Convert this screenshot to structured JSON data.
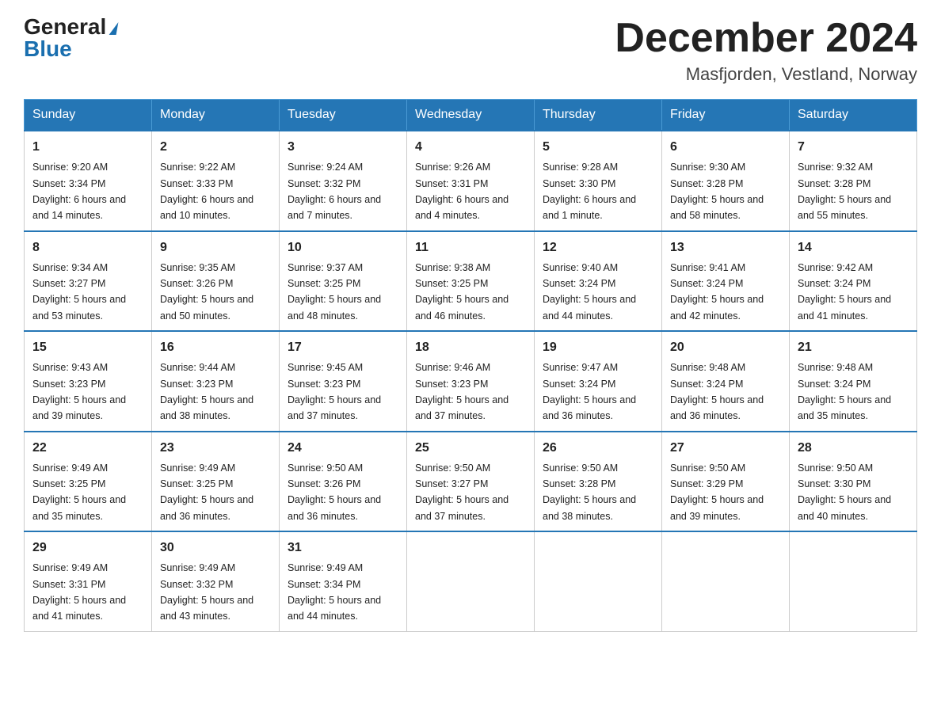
{
  "header": {
    "logo": {
      "general": "General",
      "blue": "Blue"
    },
    "month_title": "December 2024",
    "location": "Masfjorden, Vestland, Norway"
  },
  "days_of_week": [
    "Sunday",
    "Monday",
    "Tuesday",
    "Wednesday",
    "Thursday",
    "Friday",
    "Saturday"
  ],
  "weeks": [
    [
      {
        "day": "1",
        "sunrise": "9:20 AM",
        "sunset": "3:34 PM",
        "daylight": "6 hours and 14 minutes."
      },
      {
        "day": "2",
        "sunrise": "9:22 AM",
        "sunset": "3:33 PM",
        "daylight": "6 hours and 10 minutes."
      },
      {
        "day": "3",
        "sunrise": "9:24 AM",
        "sunset": "3:32 PM",
        "daylight": "6 hours and 7 minutes."
      },
      {
        "day": "4",
        "sunrise": "9:26 AM",
        "sunset": "3:31 PM",
        "daylight": "6 hours and 4 minutes."
      },
      {
        "day": "5",
        "sunrise": "9:28 AM",
        "sunset": "3:30 PM",
        "daylight": "6 hours and 1 minute."
      },
      {
        "day": "6",
        "sunrise": "9:30 AM",
        "sunset": "3:28 PM",
        "daylight": "5 hours and 58 minutes."
      },
      {
        "day": "7",
        "sunrise": "9:32 AM",
        "sunset": "3:28 PM",
        "daylight": "5 hours and 55 minutes."
      }
    ],
    [
      {
        "day": "8",
        "sunrise": "9:34 AM",
        "sunset": "3:27 PM",
        "daylight": "5 hours and 53 minutes."
      },
      {
        "day": "9",
        "sunrise": "9:35 AM",
        "sunset": "3:26 PM",
        "daylight": "5 hours and 50 minutes."
      },
      {
        "day": "10",
        "sunrise": "9:37 AM",
        "sunset": "3:25 PM",
        "daylight": "5 hours and 48 minutes."
      },
      {
        "day": "11",
        "sunrise": "9:38 AM",
        "sunset": "3:25 PM",
        "daylight": "5 hours and 46 minutes."
      },
      {
        "day": "12",
        "sunrise": "9:40 AM",
        "sunset": "3:24 PM",
        "daylight": "5 hours and 44 minutes."
      },
      {
        "day": "13",
        "sunrise": "9:41 AM",
        "sunset": "3:24 PM",
        "daylight": "5 hours and 42 minutes."
      },
      {
        "day": "14",
        "sunrise": "9:42 AM",
        "sunset": "3:24 PM",
        "daylight": "5 hours and 41 minutes."
      }
    ],
    [
      {
        "day": "15",
        "sunrise": "9:43 AM",
        "sunset": "3:23 PM",
        "daylight": "5 hours and 39 minutes."
      },
      {
        "day": "16",
        "sunrise": "9:44 AM",
        "sunset": "3:23 PM",
        "daylight": "5 hours and 38 minutes."
      },
      {
        "day": "17",
        "sunrise": "9:45 AM",
        "sunset": "3:23 PM",
        "daylight": "5 hours and 37 minutes."
      },
      {
        "day": "18",
        "sunrise": "9:46 AM",
        "sunset": "3:23 PM",
        "daylight": "5 hours and 37 minutes."
      },
      {
        "day": "19",
        "sunrise": "9:47 AM",
        "sunset": "3:24 PM",
        "daylight": "5 hours and 36 minutes."
      },
      {
        "day": "20",
        "sunrise": "9:48 AM",
        "sunset": "3:24 PM",
        "daylight": "5 hours and 36 minutes."
      },
      {
        "day": "21",
        "sunrise": "9:48 AM",
        "sunset": "3:24 PM",
        "daylight": "5 hours and 35 minutes."
      }
    ],
    [
      {
        "day": "22",
        "sunrise": "9:49 AM",
        "sunset": "3:25 PM",
        "daylight": "5 hours and 35 minutes."
      },
      {
        "day": "23",
        "sunrise": "9:49 AM",
        "sunset": "3:25 PM",
        "daylight": "5 hours and 36 minutes."
      },
      {
        "day": "24",
        "sunrise": "9:50 AM",
        "sunset": "3:26 PM",
        "daylight": "5 hours and 36 minutes."
      },
      {
        "day": "25",
        "sunrise": "9:50 AM",
        "sunset": "3:27 PM",
        "daylight": "5 hours and 37 minutes."
      },
      {
        "day": "26",
        "sunrise": "9:50 AM",
        "sunset": "3:28 PM",
        "daylight": "5 hours and 38 minutes."
      },
      {
        "day": "27",
        "sunrise": "9:50 AM",
        "sunset": "3:29 PM",
        "daylight": "5 hours and 39 minutes."
      },
      {
        "day": "28",
        "sunrise": "9:50 AM",
        "sunset": "3:30 PM",
        "daylight": "5 hours and 40 minutes."
      }
    ],
    [
      {
        "day": "29",
        "sunrise": "9:49 AM",
        "sunset": "3:31 PM",
        "daylight": "5 hours and 41 minutes."
      },
      {
        "day": "30",
        "sunrise": "9:49 AM",
        "sunset": "3:32 PM",
        "daylight": "5 hours and 43 minutes."
      },
      {
        "day": "31",
        "sunrise": "9:49 AM",
        "sunset": "3:34 PM",
        "daylight": "5 hours and 44 minutes."
      },
      null,
      null,
      null,
      null
    ]
  ],
  "labels": {
    "sunrise": "Sunrise:",
    "sunset": "Sunset:",
    "daylight": "Daylight:"
  }
}
